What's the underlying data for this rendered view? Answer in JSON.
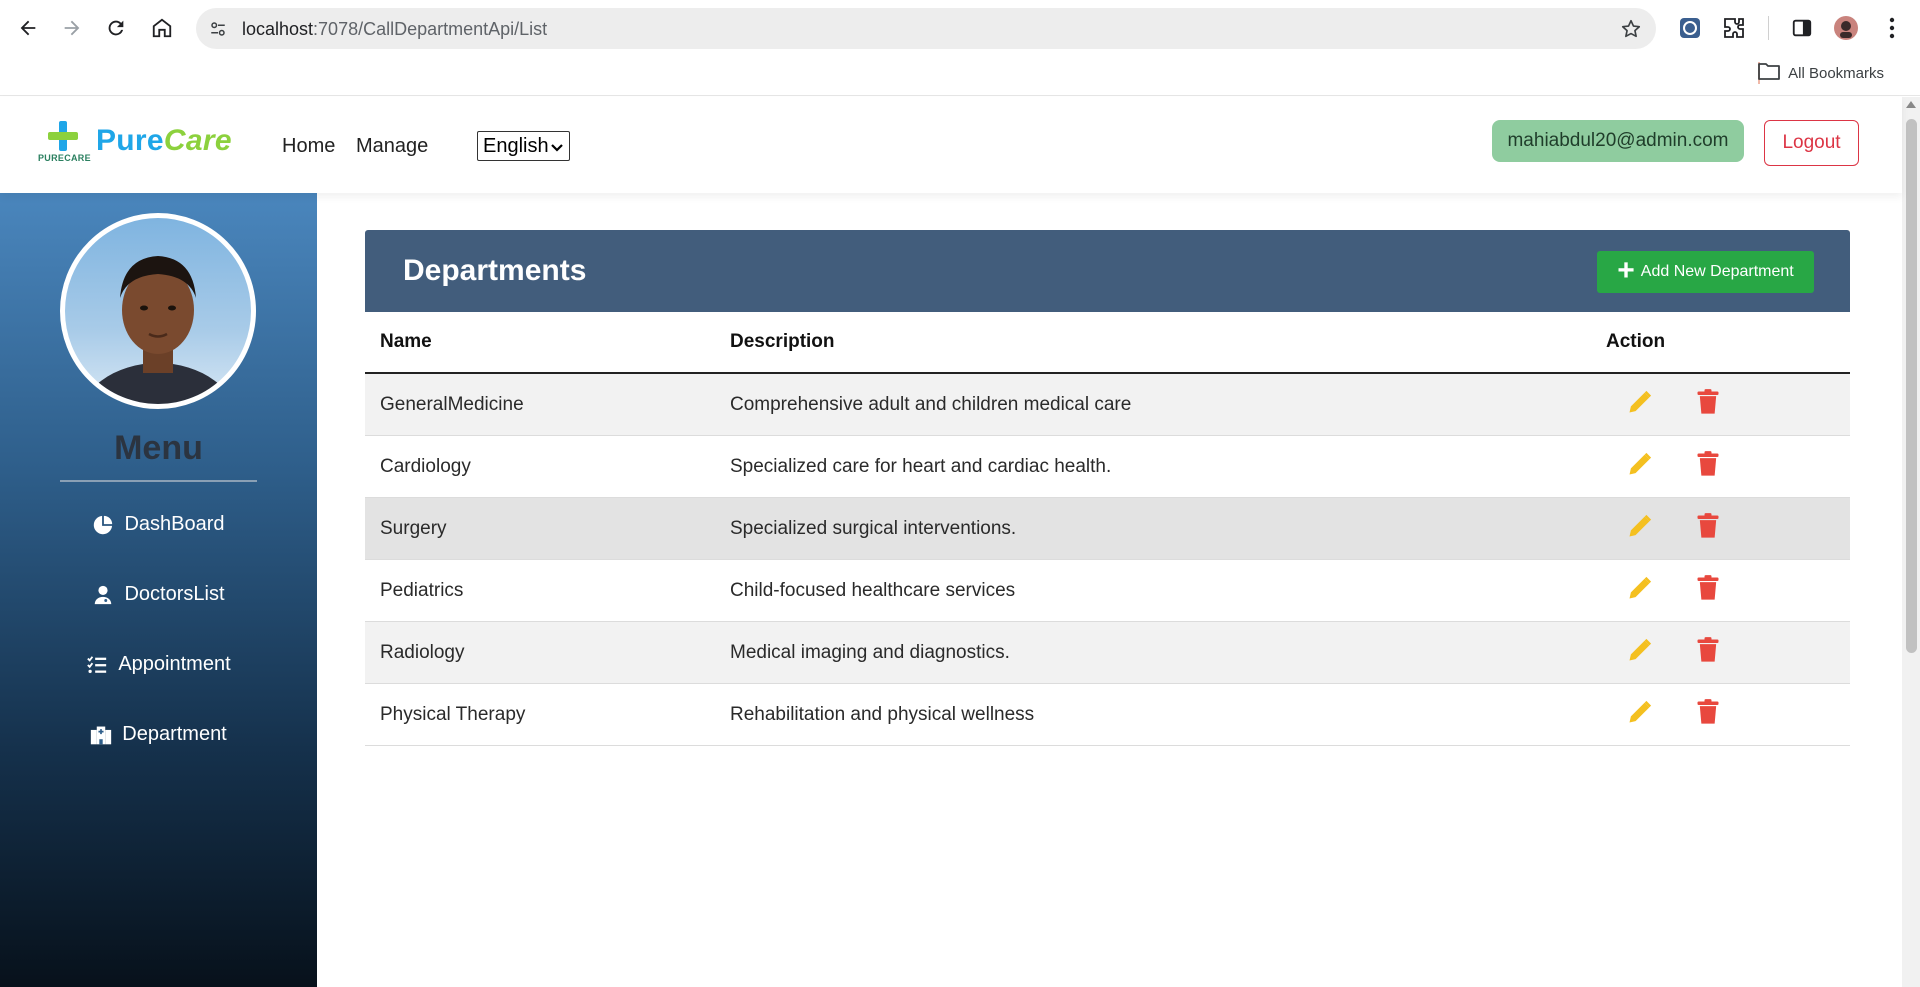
{
  "browser": {
    "url_host": "localhost",
    "url_rest": ":7078/CallDepartmentApi/List",
    "bookmarks_label": "All Bookmarks",
    "icons": [
      "back-icon",
      "forward-icon",
      "reload-icon",
      "home-icon",
      "site-settings-icon",
      "bookmark-star-icon",
      "extension-shield-icon",
      "extensions-puzzle-icon",
      "side-panel-icon",
      "profile-avatar-icon",
      "menu-kebab-icon",
      "folder-icon"
    ]
  },
  "navbar": {
    "brand_part1": "Pure",
    "brand_part2": "Care",
    "brand_sub": "PURECARE",
    "links": [
      "Home",
      "Manage"
    ],
    "language": "English",
    "user_email": "mahiabdul20@admin.com",
    "logout_label": "Logout"
  },
  "sidebar": {
    "menu_title": "Menu",
    "items": [
      {
        "label": "DashBoard",
        "icon": "pie-chart-icon"
      },
      {
        "label": "DoctorsList",
        "icon": "doctor-icon"
      },
      {
        "label": "Appointment",
        "icon": "list-check-icon"
      },
      {
        "label": "Department",
        "icon": "hospital-icon"
      }
    ]
  },
  "main": {
    "title": "Departments",
    "add_button_label": "Add New Department",
    "table": {
      "headers": [
        "Name",
        "Description",
        "Action"
      ],
      "rows": [
        {
          "name": "GeneralMedicine",
          "description": "Comprehensive adult and children medical care"
        },
        {
          "name": "Cardiology",
          "description": "Specialized care for heart and cardiac health."
        },
        {
          "name": "Surgery",
          "description": "Specialized surgical interventions."
        },
        {
          "name": "Pediatrics",
          "description": "Child-focused healthcare services"
        },
        {
          "name": "Radiology",
          "description": "Medical imaging and diagnostics."
        },
        {
          "name": "Physical Therapy",
          "description": "Rehabilitation and physical wellness"
        }
      ]
    }
  },
  "colors": {
    "header_bg": "#425d7c",
    "add_button": "#28a745",
    "edit_icon": "#f4c020",
    "delete_icon": "#e8483e",
    "logout": "#dc3545",
    "user_badge": "#8fcc9f",
    "brand_blue": "#1fa6e8",
    "brand_green": "#8cd13d"
  }
}
